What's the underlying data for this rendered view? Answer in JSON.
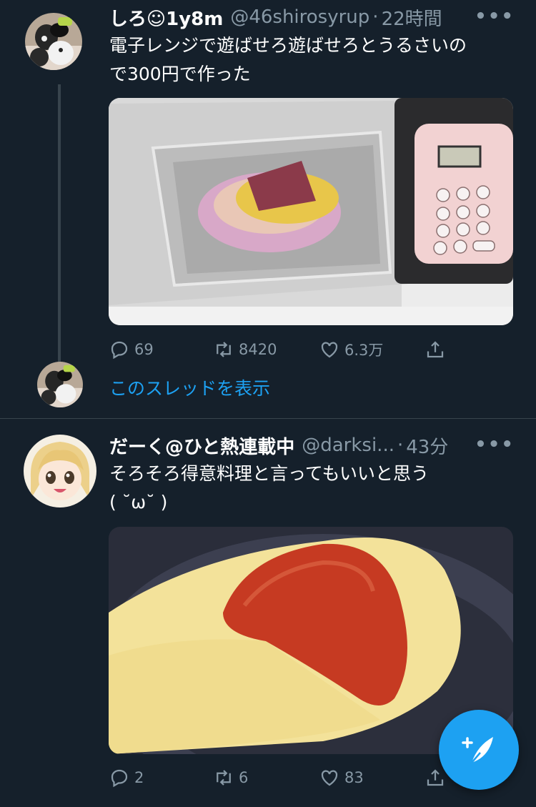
{
  "tweets": [
    {
      "name": "しろ☺1y8m",
      "handle": "@46shirosyrup",
      "dot": "·",
      "time": "22時間",
      "more": "•••",
      "text_line1": "電子レンジで遊ばせろ遊ばせろとうるさいの",
      "text_line2": "で300円で作った",
      "replies": "69",
      "retweets": "8420",
      "likes": "6.3万",
      "media_icon": "toy-microwave-photo"
    },
    {
      "name": "だーく@ひと熱連載中",
      "handle": "@darksi...",
      "dot": "·",
      "time": "43分",
      "more": "•••",
      "text_line1": "そろそろ得意料理と言ってもいいと思う",
      "text_line2": "( ˘ω˘ )",
      "replies": "2",
      "retweets": "6",
      "likes": "83",
      "media_icon": "omurice-photo"
    }
  ],
  "thread": {
    "link_label": "このスレッドを表示"
  },
  "colors": {
    "background": "#15202b",
    "accent": "#1da1f2",
    "muted": "#8899a6",
    "divider": "#38444d"
  },
  "fab": {
    "icon": "compose-tweet-icon"
  }
}
